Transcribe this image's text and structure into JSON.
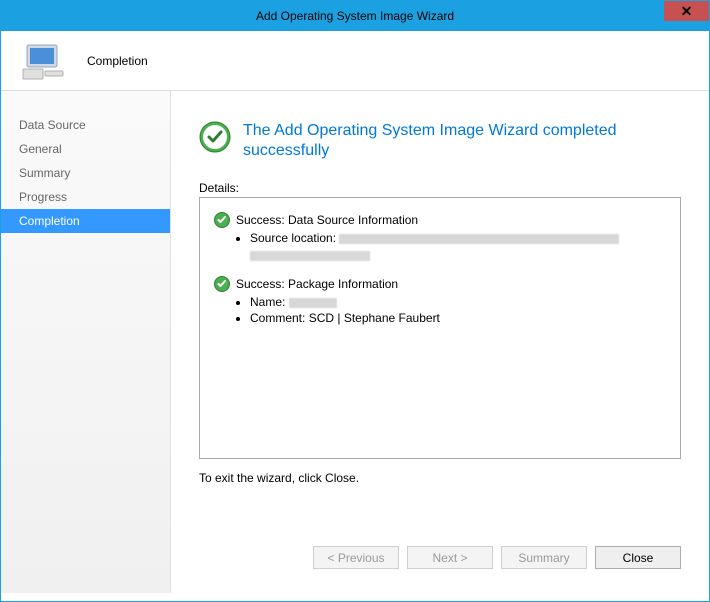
{
  "window": {
    "title": "Add Operating System Image Wizard"
  },
  "header": {
    "title": "Completion"
  },
  "sidebar": {
    "items": [
      {
        "label": "Data Source",
        "active": false
      },
      {
        "label": "General",
        "active": false
      },
      {
        "label": "Summary",
        "active": false
      },
      {
        "label": "Progress",
        "active": false
      },
      {
        "label": "Completion",
        "active": true
      }
    ]
  },
  "main": {
    "success_title": "The Add Operating System Image Wizard completed successfully",
    "details_label": "Details:",
    "sections": [
      {
        "title": "Success: Data Source Information",
        "items": [
          {
            "label": "Source location:",
            "value": "(redacted)"
          }
        ]
      },
      {
        "title": "Success: Package Information",
        "items": [
          {
            "label": "Name:",
            "value": "(redacted)"
          },
          {
            "label": "Comment:",
            "value": "SCD | Stephane Faubert"
          }
        ]
      }
    ],
    "exit_text": "To exit the wizard, click Close."
  },
  "buttons": {
    "previous": "< Previous",
    "next": "Next >",
    "summary": "Summary",
    "close": "Close"
  }
}
